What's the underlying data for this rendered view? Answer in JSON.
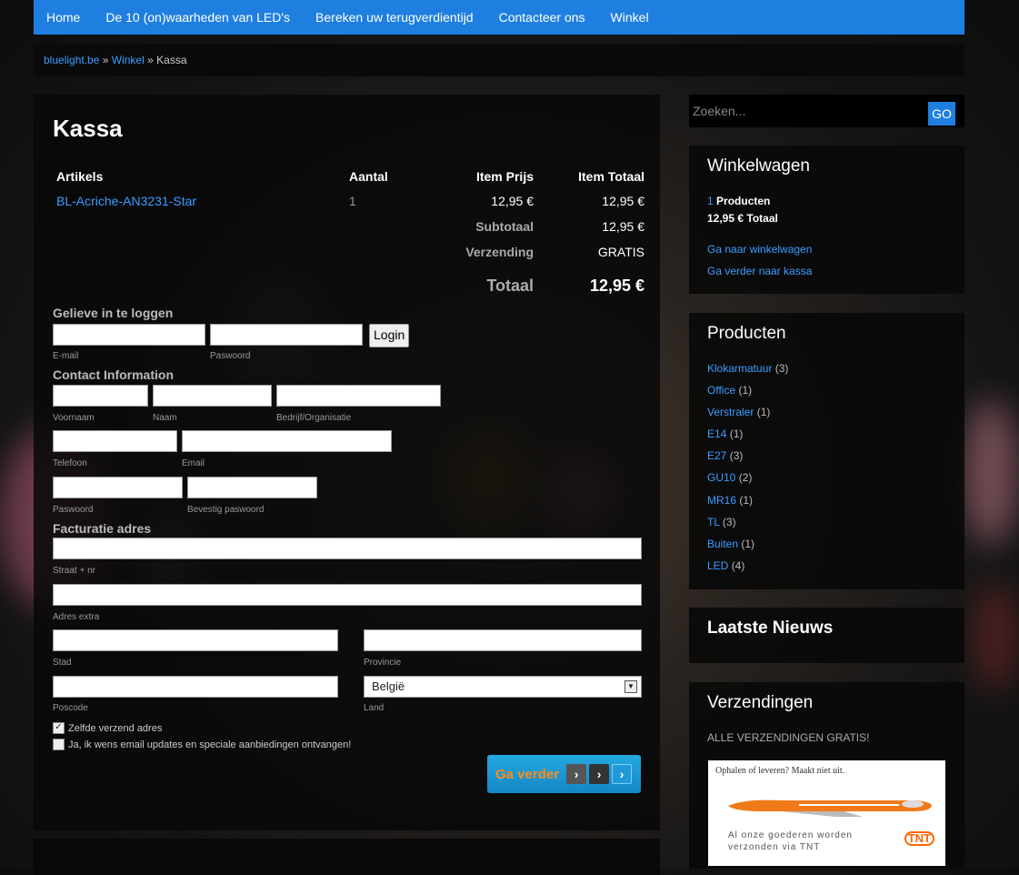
{
  "nav": [
    "Home",
    "De 10 (on)waarheden van LED's",
    "Bereken uw terugverdientijd",
    "Contacteer ons",
    "Winkel"
  ],
  "breadcrumb": {
    "site": "bluelight.be",
    "sep1": "»",
    "shop": "Winkel",
    "sep2": "»",
    "current": "Kassa"
  },
  "page": {
    "title": "Kassa"
  },
  "cart": {
    "headers": {
      "article": "Artikels",
      "qty": "Aantal",
      "price": "Item Prijs",
      "total": "Item Totaal"
    },
    "item": {
      "name": "BL-Acriche-AN3231-Star",
      "qty": "1",
      "price": "12,95 €",
      "total": "12,95 €"
    },
    "subtotal_label": "Subtotaal",
    "subtotal": "12,95 €",
    "shipping_label": "Verzending",
    "shipping": "GRATIS",
    "total_label": "Totaal",
    "total": "12,95 €"
  },
  "login": {
    "title": "Gelieve in te loggen",
    "email_label": "E-mail",
    "password_label": "Paswoord",
    "button": "Login"
  },
  "contact": {
    "title": "Contact Information",
    "first_label": "Voornaam",
    "last_label": "Naam",
    "company_label": "Bedrijf/Organisatie",
    "phone_label": "Telefoon",
    "email_label": "Email",
    "pw_label": "Paswoord",
    "pw2_label": "Bevestig paswoord"
  },
  "billing": {
    "title": "Facturatie adres",
    "street_label": "Straat + nr",
    "extra_label": "Adres extra",
    "city_label": "Stad",
    "province_label": "Provincie",
    "zip_label": "Poscode",
    "country_label": "Land",
    "country_value": "België",
    "same_ship": "Zelfde verzend adres",
    "newsletter": "Ja, ik wens email updates en speciale aanbiedingen ontvangen!",
    "next_button": "Ga verder"
  },
  "search": {
    "placeholder": "Zoeken...",
    "button": "GO"
  },
  "cart_widget": {
    "title": "Winkelwagen",
    "count": "1",
    "count_label": "Producten",
    "total": "12,95 €",
    "total_label": "Totaal",
    "link_cart": "Ga naar winkelwagen",
    "link_checkout": "Ga verder naar kassa"
  },
  "products_widget": {
    "title": "Producten",
    "items": [
      {
        "name": "Klokarmatuur",
        "count": "(3)"
      },
      {
        "name": "Office",
        "count": "(1)"
      },
      {
        "name": "Verstraler",
        "count": "(1)"
      },
      {
        "name": "E14",
        "count": "(1)"
      },
      {
        "name": "E27",
        "count": "(3)"
      },
      {
        "name": "GU10",
        "count": "(2)"
      },
      {
        "name": "MR16",
        "count": "(1)"
      },
      {
        "name": "TL",
        "count": "(3)"
      },
      {
        "name": "Buiten",
        "count": "(1)"
      },
      {
        "name": "LED",
        "count": "(4)"
      }
    ]
  },
  "news_widget": {
    "title": "Laatste Nieuws"
  },
  "shipping_widget": {
    "title": "Verzendingen",
    "text": "ALLE VERZENDINGEN GRATIS!",
    "banner_top": "Ophalen of leveren? Maakt niet uit.",
    "banner_bottom_1": "Al onze goederen worden",
    "banner_bottom_2": "verzonden via TNT",
    "logo": "TNT"
  },
  "colors": {
    "nav": "#1f7fe0",
    "link": "#3b9cff",
    "accent": "#ff8c1a",
    "button": "#1487c6"
  }
}
